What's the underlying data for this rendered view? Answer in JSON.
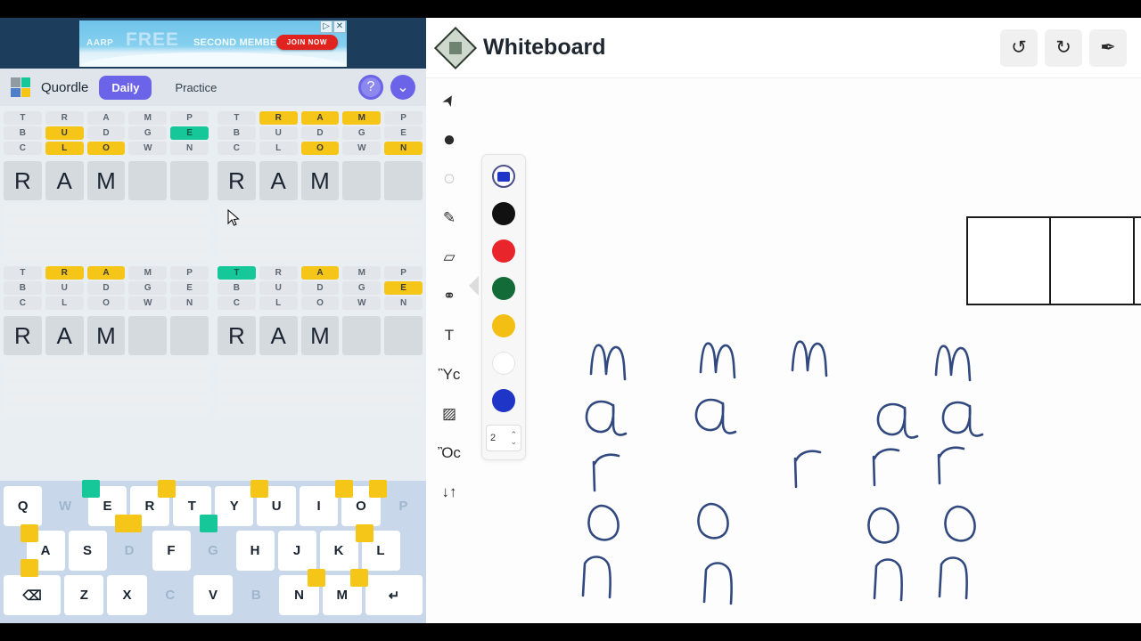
{
  "quordle": {
    "ad": {
      "brand": "AARP",
      "headline": "FREE",
      "subhead": "SECOND MEMBERSHIP",
      "cta": "JOIN NOW",
      "info_glyph": "▷",
      "close_glyph": "✕"
    },
    "header": {
      "title": "Quordle",
      "tabs": [
        {
          "label": "Daily",
          "active": true
        },
        {
          "label": "Practice",
          "active": false
        }
      ],
      "help_glyph": "?",
      "menu_glyph": "⌄",
      "accent_color": "#6b63e8",
      "logo_colors": [
        "#8f9aa3",
        "#16c79a",
        "#4f7ec9",
        "#f5c518"
      ]
    },
    "colors": {
      "correct": "#16c79a",
      "present": "#f5c518",
      "absent": "#e2e6ea",
      "tile_bg": "#d5dade"
    },
    "boards": [
      {
        "name": "board-top-left",
        "guesses": [
          {
            "letters": [
              "T",
              "R",
              "A",
              "M",
              "P"
            ],
            "states": [
              "absent",
              "absent",
              "absent",
              "absent",
              "absent"
            ]
          },
          {
            "letters": [
              "B",
              "U",
              "D",
              "G",
              "E"
            ],
            "states": [
              "absent",
              "present",
              "absent",
              "absent",
              "correct"
            ]
          },
          {
            "letters": [
              "C",
              "L",
              "O",
              "W",
              "N"
            ],
            "states": [
              "absent",
              "present",
              "present",
              "absent",
              "absent"
            ]
          }
        ],
        "current": [
          "R",
          "A",
          "M",
          "",
          ""
        ]
      },
      {
        "name": "board-top-right",
        "guesses": [
          {
            "letters": [
              "T",
              "R",
              "A",
              "M",
              "P"
            ],
            "states": [
              "absent",
              "present",
              "present",
              "present",
              "absent"
            ]
          },
          {
            "letters": [
              "B",
              "U",
              "D",
              "G",
              "E"
            ],
            "states": [
              "absent",
              "absent",
              "absent",
              "absent",
              "absent"
            ]
          },
          {
            "letters": [
              "C",
              "L",
              "O",
              "W",
              "N"
            ],
            "states": [
              "absent",
              "absent",
              "present",
              "absent",
              "present"
            ]
          }
        ],
        "current": [
          "R",
          "A",
          "M",
          "",
          ""
        ]
      },
      {
        "name": "board-bottom-left",
        "guesses": [
          {
            "letters": [
              "T",
              "R",
              "A",
              "M",
              "P"
            ],
            "states": [
              "absent",
              "present",
              "present",
              "absent",
              "absent"
            ]
          },
          {
            "letters": [
              "B",
              "U",
              "D",
              "G",
              "E"
            ],
            "states": [
              "absent",
              "absent",
              "absent",
              "absent",
              "absent"
            ]
          },
          {
            "letters": [
              "C",
              "L",
              "O",
              "W",
              "N"
            ],
            "states": [
              "absent",
              "absent",
              "absent",
              "absent",
              "absent"
            ]
          }
        ],
        "current": [
          "R",
          "A",
          "M",
          "",
          ""
        ]
      },
      {
        "name": "board-bottom-right",
        "guesses": [
          {
            "letters": [
              "T",
              "R",
              "A",
              "M",
              "P"
            ],
            "states": [
              "correct",
              "absent",
              "present",
              "absent",
              "absent"
            ]
          },
          {
            "letters": [
              "B",
              "U",
              "D",
              "G",
              "E"
            ],
            "states": [
              "absent",
              "absent",
              "absent",
              "absent",
              "present"
            ]
          },
          {
            "letters": [
              "C",
              "L",
              "O",
              "W",
              "N"
            ],
            "states": [
              "absent",
              "absent",
              "absent",
              "absent",
              "absent"
            ]
          }
        ],
        "current": [
          "R",
          "A",
          "M",
          "",
          ""
        ]
      }
    ],
    "keyboard": {
      "rows": [
        [
          {
            "key": "Q",
            "dim": false,
            "marks": []
          },
          {
            "key": "W",
            "dim": true,
            "marks": []
          },
          {
            "key": "E",
            "dim": false,
            "marks": [
              {
                "pos": "tl",
                "state": "correct"
              },
              {
                "pos": "br",
                "state": "present"
              }
            ]
          },
          {
            "key": "R",
            "dim": false,
            "marks": [
              {
                "pos": "tr",
                "state": "present"
              },
              {
                "pos": "bl",
                "state": "present"
              }
            ]
          },
          {
            "key": "T",
            "dim": false,
            "marks": [
              {
                "pos": "br",
                "state": "correct"
              }
            ]
          },
          {
            "key": "Y",
            "dim": false,
            "marks": []
          },
          {
            "key": "U",
            "dim": false,
            "marks": [
              {
                "pos": "tl",
                "state": "present"
              }
            ]
          },
          {
            "key": "I",
            "dim": false,
            "marks": []
          },
          {
            "key": "O",
            "dim": false,
            "marks": [
              {
                "pos": "tl",
                "state": "present"
              },
              {
                "pos": "tr",
                "state": "present"
              }
            ]
          },
          {
            "key": "P",
            "dim": true,
            "marks": []
          }
        ],
        [
          {
            "key": "A",
            "dim": false,
            "marks": [
              {
                "pos": "tl",
                "state": "present"
              },
              {
                "pos": "bl",
                "state": "present"
              }
            ]
          },
          {
            "key": "S",
            "dim": false,
            "marks": []
          },
          {
            "key": "D",
            "dim": true,
            "marks": []
          },
          {
            "key": "F",
            "dim": false,
            "marks": []
          },
          {
            "key": "G",
            "dim": true,
            "marks": []
          },
          {
            "key": "H",
            "dim": false,
            "marks": []
          },
          {
            "key": "J",
            "dim": false,
            "marks": []
          },
          {
            "key": "K",
            "dim": false,
            "marks": []
          },
          {
            "key": "L",
            "dim": false,
            "marks": [
              {
                "pos": "tl",
                "state": "present"
              }
            ]
          }
        ],
        [
          {
            "key": "⌫",
            "dim": false,
            "marks": [],
            "wide": true,
            "name": "backspace"
          },
          {
            "key": "Z",
            "dim": false,
            "marks": []
          },
          {
            "key": "X",
            "dim": false,
            "marks": []
          },
          {
            "key": "C",
            "dim": true,
            "marks": []
          },
          {
            "key": "V",
            "dim": false,
            "marks": []
          },
          {
            "key": "B",
            "dim": true,
            "marks": []
          },
          {
            "key": "N",
            "dim": false,
            "marks": [
              {
                "pos": "tr",
                "state": "present"
              }
            ]
          },
          {
            "key": "M",
            "dim": false,
            "marks": [
              {
                "pos": "tr",
                "state": "present"
              }
            ]
          },
          {
            "key": "↵",
            "dim": false,
            "marks": [],
            "wide": true,
            "name": "enter"
          }
        ]
      ]
    }
  },
  "whiteboard": {
    "title": "Whiteboard",
    "actions": [
      {
        "name": "undo-button",
        "glyph": "↺"
      },
      {
        "name": "redo-button",
        "glyph": "↻"
      },
      {
        "name": "pin-button",
        "glyph": "✒"
      }
    ],
    "tools": [
      {
        "name": "select-tool",
        "glyph": "➤"
      },
      {
        "name": "filled-circle-tool",
        "glyph": "●"
      },
      {
        "name": "outline-circle-tool",
        "glyph": "○"
      },
      {
        "name": "pencil-tool",
        "glyph": "✎"
      },
      {
        "name": "eraser-tool",
        "glyph": "▱"
      },
      {
        "name": "shapes-tool",
        "glyph": "⚭"
      },
      {
        "name": "text-tool",
        "glyph": "T"
      },
      {
        "name": "image-tool",
        "glyph": "Ὓc"
      },
      {
        "name": "sticker-tool",
        "glyph": "▨"
      },
      {
        "name": "comment-tool",
        "glyph": "Ὂc"
      },
      {
        "name": "arrange-tool",
        "glyph": "↓↑"
      }
    ],
    "palette": {
      "current_color": "#1e35c8",
      "swatches": [
        {
          "name": "black",
          "hex": "#111111"
        },
        {
          "name": "red",
          "hex": "#e8252a"
        },
        {
          "name": "green",
          "hex": "#136b37"
        },
        {
          "name": "yellow",
          "hex": "#f2bf12"
        },
        {
          "name": "white",
          "hex": "#ffffff"
        },
        {
          "name": "blue",
          "hex": "#1e35c8"
        }
      ],
      "stroke_width": "2",
      "stepper_up": "⌃",
      "stepper_down": "⌄"
    },
    "canvas": {
      "word_box_count": 5,
      "handwriting_color": "#31497f",
      "rows": [
        {
          "letter": "m",
          "columns": [
            1,
            2,
            3,
            5
          ]
        },
        {
          "letter": "a",
          "columns": [
            1,
            2,
            4,
            5
          ]
        },
        {
          "letter": "r",
          "columns": [
            1,
            3,
            4,
            5
          ]
        },
        {
          "letter": "o",
          "columns": [
            1,
            2,
            4,
            5
          ]
        },
        {
          "letter": "n",
          "columns": [
            1,
            2,
            4,
            5
          ]
        }
      ]
    }
  }
}
